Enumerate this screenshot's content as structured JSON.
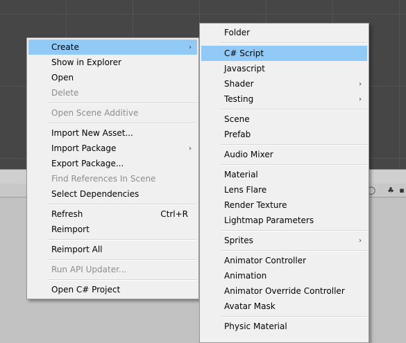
{
  "context_menu": {
    "items": [
      {
        "label": "Create",
        "submenu": true,
        "highlighted": true
      },
      {
        "label": "Show in Explorer"
      },
      {
        "label": "Open"
      },
      {
        "label": "Delete",
        "disabled": true
      },
      {
        "label": "Open Scene Additive",
        "disabled": true
      },
      {
        "label": "Import New Asset..."
      },
      {
        "label": "Import Package",
        "submenu": true
      },
      {
        "label": "Export Package..."
      },
      {
        "label": "Find References In Scene",
        "disabled": true
      },
      {
        "label": "Select Dependencies"
      },
      {
        "label": "Refresh",
        "shortcut": "Ctrl+R"
      },
      {
        "label": "Reimport"
      },
      {
        "label": "Reimport All"
      },
      {
        "label": "Run API Updater...",
        "disabled": true
      },
      {
        "label": "Open C# Project"
      }
    ]
  },
  "create_submenu": {
    "items": [
      {
        "label": "Folder"
      },
      {
        "label": "C# Script",
        "highlighted": true
      },
      {
        "label": "Javascript"
      },
      {
        "label": "Shader",
        "submenu": true
      },
      {
        "label": "Testing",
        "submenu": true
      },
      {
        "label": "Scene"
      },
      {
        "label": "Prefab"
      },
      {
        "label": "Audio Mixer"
      },
      {
        "label": "Material"
      },
      {
        "label": "Lens Flare"
      },
      {
        "label": "Render Texture"
      },
      {
        "label": "Lightmap Parameters"
      },
      {
        "label": "Sprites",
        "submenu": true
      },
      {
        "label": "Animator Controller"
      },
      {
        "label": "Animation"
      },
      {
        "label": "Animator Override Controller"
      },
      {
        "label": "Avatar Mask"
      },
      {
        "label": "Physic Material"
      }
    ]
  },
  "icons": {
    "submenu_arrow": "chevron-right-icon",
    "toolbar_left": "circle-icon",
    "toolbar_right": "filter-icon"
  },
  "colors": {
    "highlight": "#91c9f7",
    "menu_bg": "#f0f0f0",
    "scene_bg": "#464646",
    "disabled_text": "#8d8d8d"
  }
}
